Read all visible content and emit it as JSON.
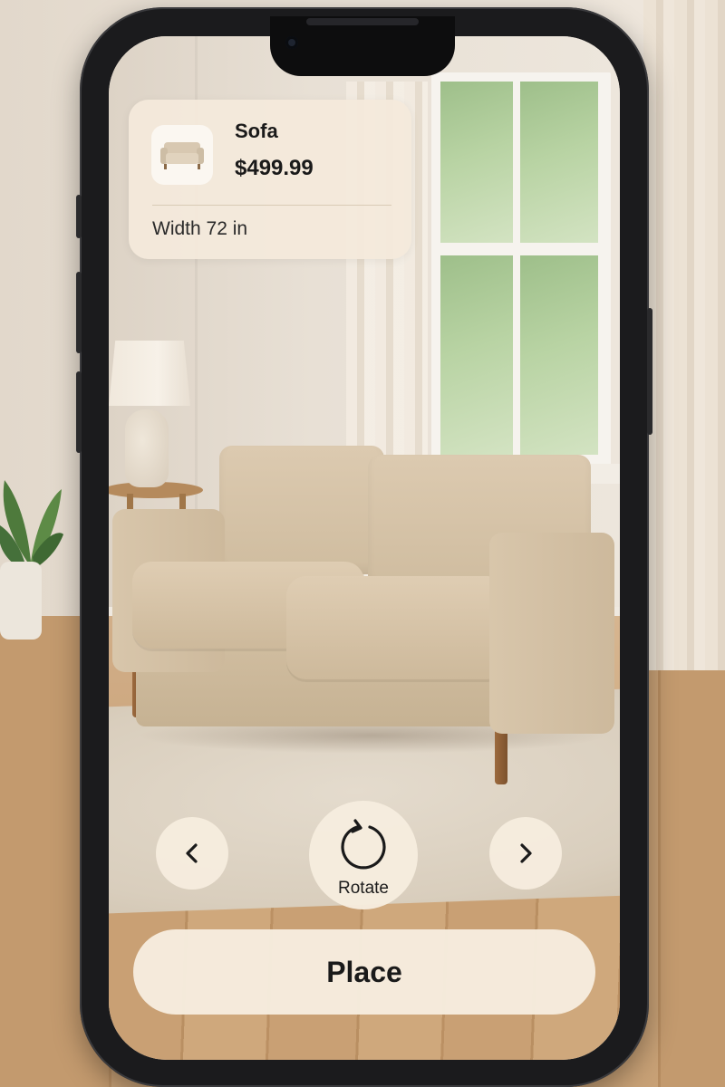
{
  "product": {
    "name": "Sofa",
    "price": "$499.99",
    "dimension": "Width 72 in"
  },
  "controls": {
    "previous_icon": "chevron-left-icon",
    "next_icon": "chevron-right-icon",
    "rotate_icon": "rotate-icon",
    "rotate_label": "Rotate",
    "place_label": "Place"
  },
  "colors": {
    "panel": "#f4eadb",
    "text": "#1a1a1a",
    "sofa": "#d8c6ab",
    "phone_frame": "#1b1b1d"
  }
}
